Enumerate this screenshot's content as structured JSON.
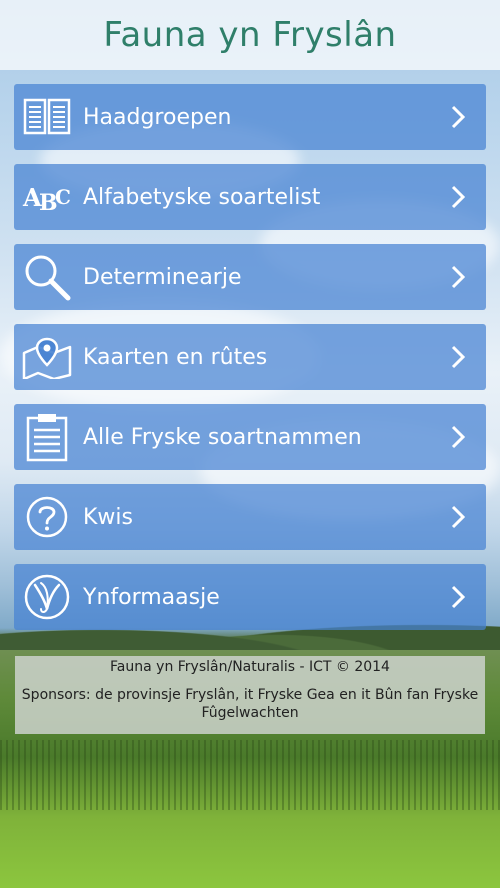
{
  "app": {
    "title": "Fauna yn Fryslân"
  },
  "menu": [
    {
      "label": "Haadgroepen",
      "icon": "book-icon"
    },
    {
      "label": "Alfabetyske soartelist",
      "icon": "abc-icon"
    },
    {
      "label": "Determinearje",
      "icon": "magnifier-icon"
    },
    {
      "label": "Kaarten en rûtes",
      "icon": "map-pin-icon"
    },
    {
      "label": "Alle Fryske soartnammen",
      "icon": "clipboard-icon"
    },
    {
      "label": "Kwis",
      "icon": "question-icon"
    },
    {
      "label": "Ynformaasje",
      "icon": "info-logo-icon"
    }
  ],
  "footer": {
    "credit": "Fauna yn Fryslân/Naturalis - ICT © 2014",
    "sponsors": "Sponsors: de provinsje Fryslân, it Fryske Gea en it Bûn fan Fryske Fûgelwachten"
  },
  "colors": {
    "title": "#2f7f6a",
    "menu_bg": "#4682d2",
    "menu_text": "#ffffff"
  }
}
